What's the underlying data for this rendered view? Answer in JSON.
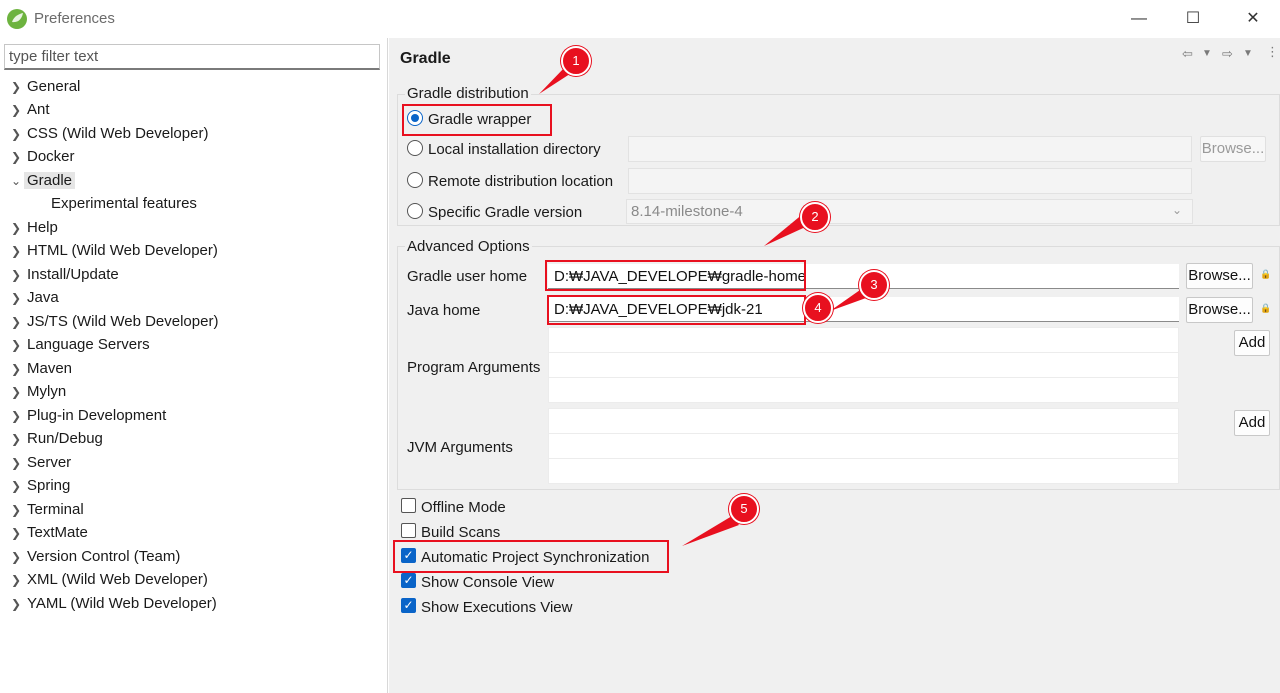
{
  "window": {
    "title": "Preferences",
    "min_icon": "minimize-icon",
    "max_icon": "maximize-icon",
    "close_icon": "close-icon"
  },
  "filter": {
    "placeholder": "type filter text",
    "value": ""
  },
  "tree": {
    "items": [
      {
        "label": "General",
        "expanded": false
      },
      {
        "label": "Ant",
        "expanded": false
      },
      {
        "label": "CSS (Wild Web Developer)",
        "expanded": false
      },
      {
        "label": "Docker",
        "expanded": false
      },
      {
        "label": "Gradle",
        "expanded": true,
        "selected": true
      },
      {
        "label": "Experimental features",
        "child": true
      },
      {
        "label": "Help",
        "expanded": false
      },
      {
        "label": "HTML (Wild Web Developer)",
        "expanded": false
      },
      {
        "label": "Install/Update",
        "expanded": false
      },
      {
        "label": "Java",
        "expanded": false
      },
      {
        "label": "JS/TS (Wild Web Developer)",
        "expanded": false
      },
      {
        "label": "Language Servers",
        "expanded": false
      },
      {
        "label": "Maven",
        "expanded": false
      },
      {
        "label": "Mylyn",
        "expanded": false
      },
      {
        "label": "Plug-in Development",
        "expanded": false
      },
      {
        "label": "Run/Debug",
        "expanded": false
      },
      {
        "label": "Server",
        "expanded": false
      },
      {
        "label": "Spring",
        "expanded": false
      },
      {
        "label": "Terminal",
        "expanded": false
      },
      {
        "label": "TextMate",
        "expanded": false
      },
      {
        "label": "Version Control (Team)",
        "expanded": false
      },
      {
        "label": "XML (Wild Web Developer)",
        "expanded": false
      },
      {
        "label": "YAML (Wild Web Developer)",
        "expanded": false
      }
    ]
  },
  "page": {
    "title": "Gradle",
    "distribution": {
      "legend": "Gradle distribution",
      "options": {
        "wrapper": "Gradle wrapper",
        "local": "Local installation directory",
        "remote": "Remote distribution location",
        "specific": "Specific Gradle version"
      },
      "selected": "wrapper",
      "version_value": "8.14-milestone-4",
      "browse_label": "Browse..."
    },
    "advanced": {
      "legend": "Advanced Options",
      "user_home_label": "Gradle user home",
      "user_home_value": "D:₩JAVA_DEVELOPE₩gradle-home",
      "java_home_label": "Java home",
      "java_home_value": "D:₩JAVA_DEVELOPE₩jdk-21",
      "browse_label": "Browse...",
      "program_args_label": "Program Arguments",
      "jvm_args_label": "JVM Arguments",
      "add_label": "Add"
    },
    "checkboxes": {
      "offline": {
        "label": "Offline Mode",
        "checked": false
      },
      "build_scans": {
        "label": "Build Scans",
        "checked": false
      },
      "auto_sync": {
        "label": "Automatic Project Synchronization",
        "checked": true
      },
      "console_view": {
        "label": "Show Console View",
        "checked": true
      },
      "executions_view": {
        "label": "Show Executions View",
        "checked": true
      }
    }
  },
  "annotations": {
    "badges": [
      "1",
      "2",
      "3",
      "4",
      "5"
    ],
    "color": "#e8101f"
  },
  "colors": {
    "accent": "#0a64c8",
    "annotation": "#e8101f"
  }
}
